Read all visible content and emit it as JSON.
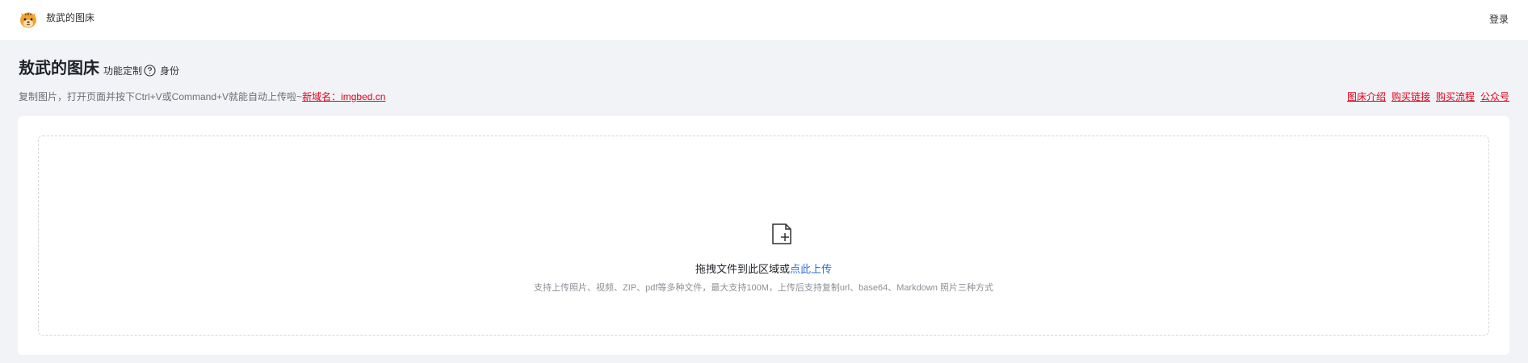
{
  "header": {
    "brand": "敖武的图床",
    "login": "登录",
    "logo_icon": "tiger-logo-icon"
  },
  "title": {
    "main": "敖武的图床",
    "feature": "功能定制",
    "help_icon": "question-circle-icon",
    "identity": "身份"
  },
  "hint": {
    "text": "复制图片，打开页面并按下Ctrl+V或Command+V就能自动上传啦~",
    "new_domain": "新域名：imgbed.cn"
  },
  "links": {
    "intro": "图床介绍",
    "buy_link": "购买链接",
    "buy_flow": "购买流程",
    "official": "公众号"
  },
  "upload": {
    "icon": "file-add-icon",
    "drag_text": "拖拽文件到此区域或",
    "click_upload": "点此上传",
    "support_text": "支持上传照片、视频、ZIP、pdf等多种文件，最大支持100M，上传后支持复制url、base64、Markdown 照片三种方式"
  },
  "colors": {
    "accent_link": "#e0001b",
    "upload_link": "#2f6fdf",
    "background": "#f2f3f7"
  }
}
